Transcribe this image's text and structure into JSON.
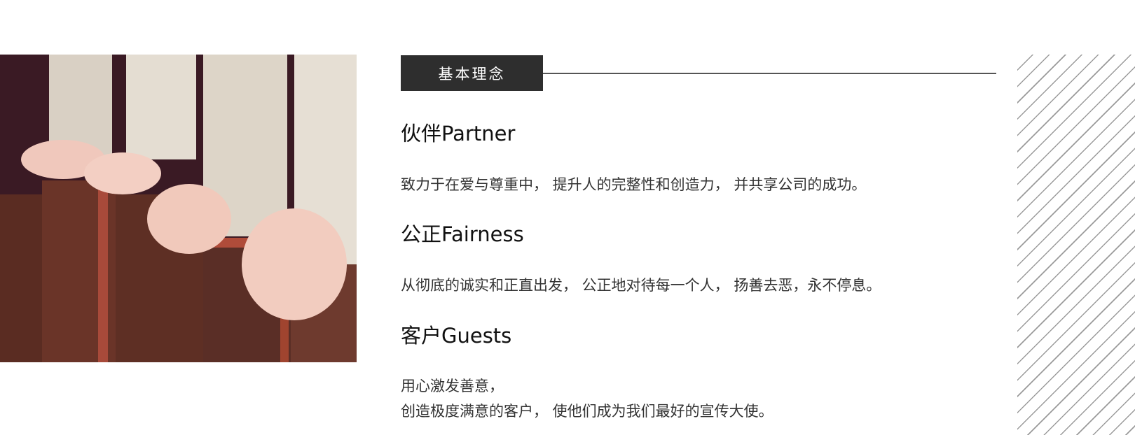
{
  "section": {
    "tag_label": "基本理念"
  },
  "values": [
    {
      "title": "伙伴Partner",
      "lines": [
        "致力于在爱与尊重中， 提升人的完整性和创造力， 并共享公司的成功。"
      ]
    },
    {
      "title": "公正Fairness",
      "lines": [
        "从彻底的诚实和正直出发， 公正地对待每一个人， 扬善去恶，永不停息。"
      ]
    },
    {
      "title": "客户Guests",
      "lines": [
        "用心激发善意，",
        "创造极度满意的客户， 使他们成为我们最好的宣传大使。"
      ]
    }
  ],
  "colors": {
    "tag_background": "#2e2e2e",
    "tag_text": "#ffffff",
    "rule_line": "#555555",
    "stripe": "#9a9a9a"
  }
}
